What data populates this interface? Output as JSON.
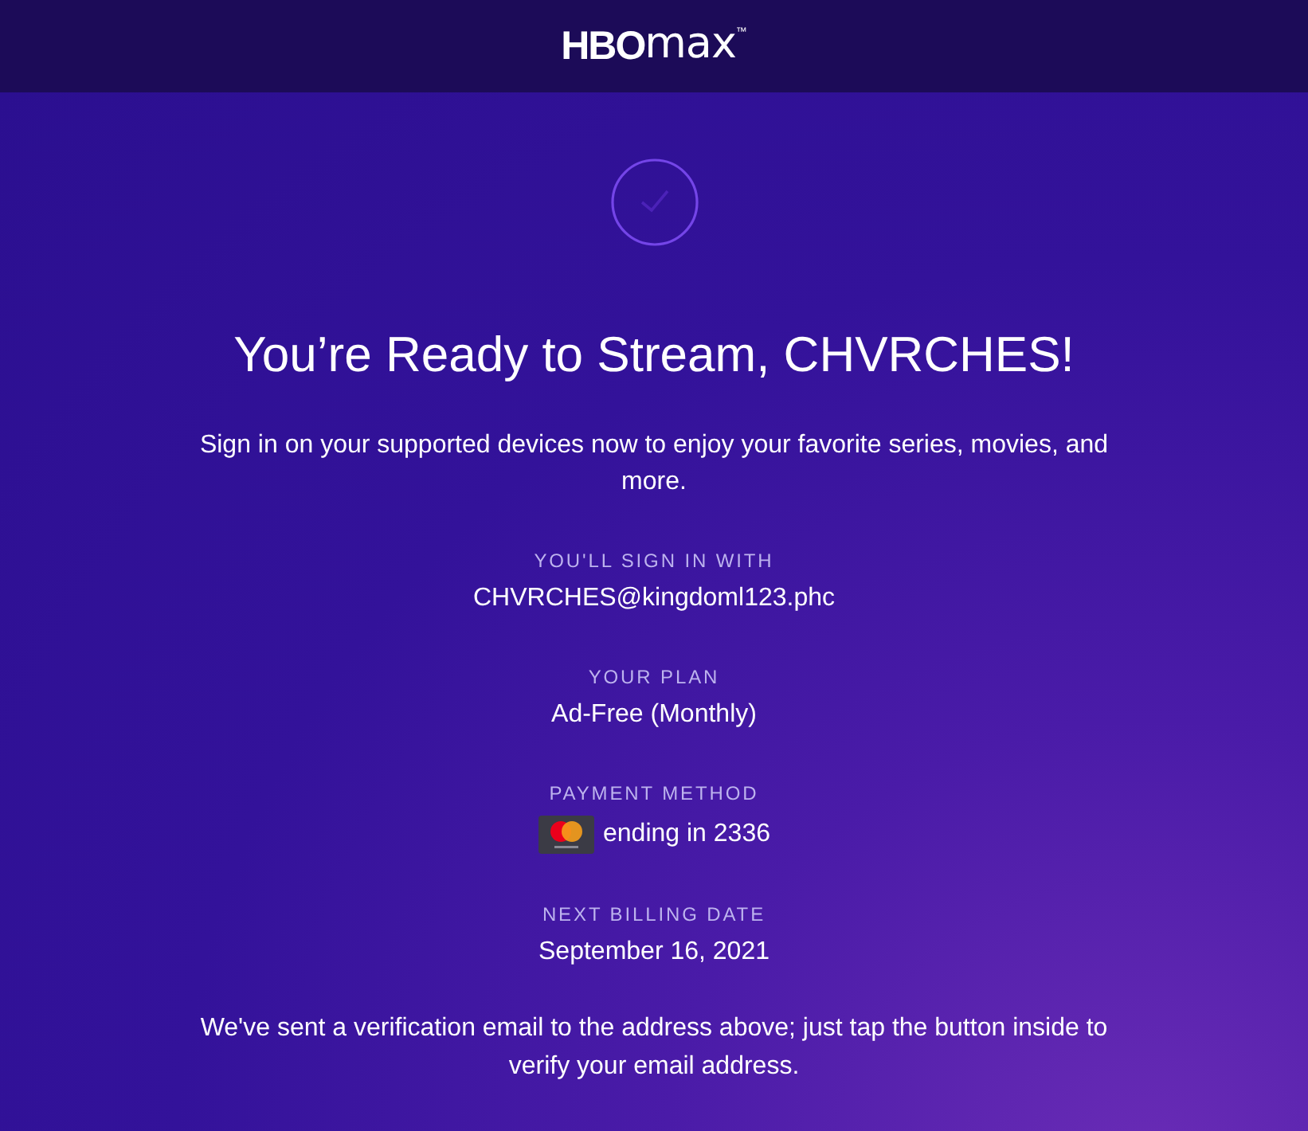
{
  "header": {
    "brand": "HBO",
    "product": "max",
    "trademark": "™"
  },
  "confirmation": {
    "title": "You’re Ready to Stream, CHVRCHES!",
    "message": "Sign in on your supported devices now to enjoy your favorite series, movies, and more."
  },
  "details": [
    {
      "kind": "text",
      "label": "YOU'LL SIGN IN WITH",
      "value": "CHVRCHES@kingdoml123.phc"
    },
    {
      "kind": "text",
      "label": "YOUR PLAN",
      "value": "Ad-Free (Monthly)"
    },
    {
      "kind": "card",
      "label": "PAYMENT METHOD",
      "value": "ending in 2336"
    },
    {
      "kind": "text",
      "label": "NEXT BILLING DATE",
      "value": "September 16, 2021"
    }
  ],
  "footer_note": "We've sent a verification email to the address above; just tap the button inside to verify your email address."
}
